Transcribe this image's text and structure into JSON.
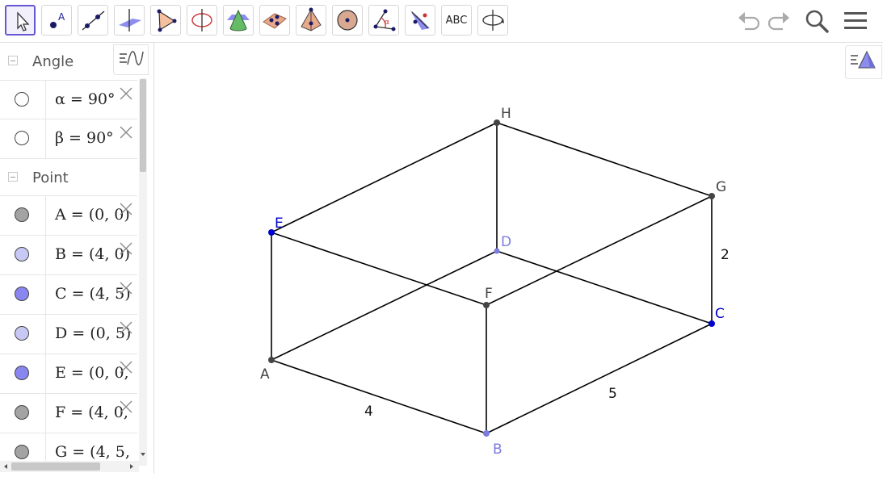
{
  "toolbar": {
    "tools": [
      {
        "name": "move-tool"
      },
      {
        "name": "point-tool",
        "label": "A"
      },
      {
        "name": "line-tool"
      },
      {
        "name": "perpendicular-line-tool"
      },
      {
        "name": "polygon-tool"
      },
      {
        "name": "circle-with-axis-tool"
      },
      {
        "name": "intersect-surfaces-tool"
      },
      {
        "name": "plane-tool"
      },
      {
        "name": "pyramid-tool"
      },
      {
        "name": "sphere-tool"
      },
      {
        "name": "angle-tool"
      },
      {
        "name": "reflect-tool"
      },
      {
        "name": "text-tool",
        "label": "ABC"
      },
      {
        "name": "rotate-view-tool"
      }
    ]
  },
  "algebra": {
    "groups": [
      {
        "title": "Angle",
        "items": [
          {
            "expr": "α = 90°",
            "marble_color": "#ffffff"
          },
          {
            "expr": "β = 90°",
            "marble_color": "#ffffff"
          }
        ]
      },
      {
        "title": "Point",
        "items": [
          {
            "expr": "A = (0, 0)",
            "marble_color": "#a3a3a3"
          },
          {
            "expr": "B = (4, 0)",
            "marble_color": "#c8c8f5"
          },
          {
            "expr": "C = (4, 5)",
            "marble_color": "#8a86f0"
          },
          {
            "expr": "D = (0, 5)",
            "marble_color": "#c8c8f5"
          },
          {
            "expr": "E = (0, 0,",
            "marble_color": "#8a86f0"
          },
          {
            "expr": "F = (4, 0,",
            "marble_color": "#a3a3a3"
          },
          {
            "expr": "G = (4, 5,",
            "marble_color": "#a3a3a3"
          }
        ]
      }
    ]
  },
  "graphics": {
    "points": [
      {
        "label": "A",
        "color": "#444444"
      },
      {
        "label": "B",
        "color": "#7b7be0"
      },
      {
        "label": "C",
        "color": "#0000cc"
      },
      {
        "label": "D",
        "color": "#7b7be0"
      },
      {
        "label": "E",
        "color": "#0000cc"
      },
      {
        "label": "F",
        "color": "#444444"
      },
      {
        "label": "G",
        "color": "#444444"
      },
      {
        "label": "H",
        "color": "#444444"
      }
    ],
    "segment_labels": [
      "4",
      "5",
      "2"
    ]
  }
}
